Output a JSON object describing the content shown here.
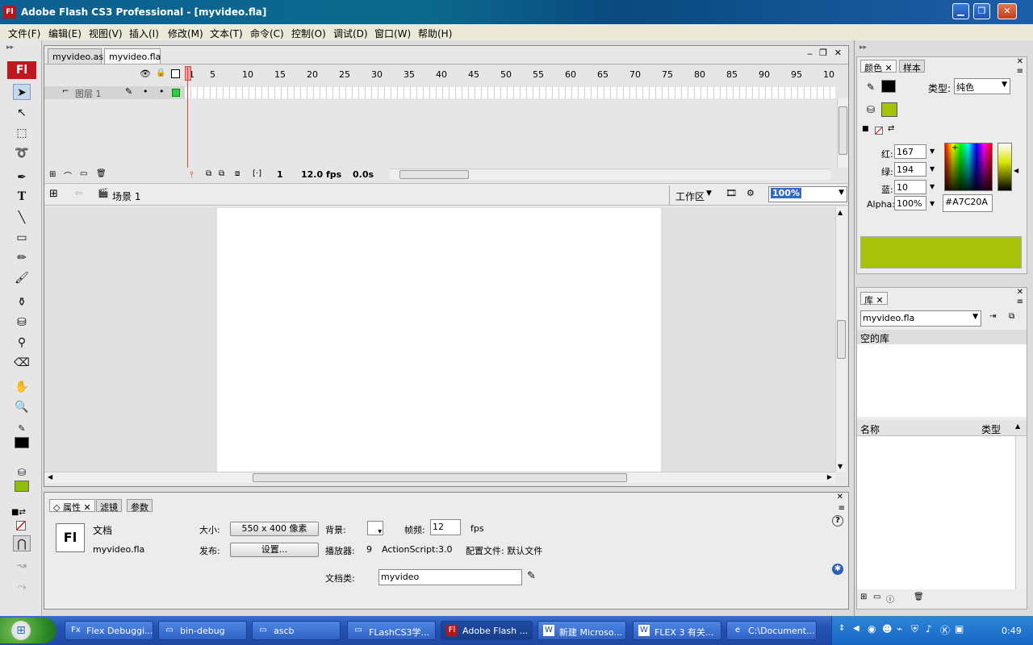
{
  "window": {
    "title": "Adobe Flash CS3 Professional - [myvideo.fla]",
    "app_icon": "Fl"
  },
  "menu": [
    "文件(F)",
    "编辑(E)",
    "视图(V)",
    "插入(I)",
    "修改(M)",
    "文本(T)",
    "命令(C)",
    "控制(O)",
    "调试(D)",
    "窗口(W)",
    "帮助(H)"
  ],
  "tools": {
    "logo": "Fl",
    "text_tool": "T"
  },
  "doc_tabs": [
    "myvideo.as",
    "myvideo.fla"
  ],
  "timeline": {
    "ruler": [
      "1",
      "5",
      "10",
      "15",
      "20",
      "25",
      "30",
      "35",
      "40",
      "45",
      "50",
      "55",
      "60",
      "65",
      "70",
      "75",
      "80",
      "85",
      "90",
      "95",
      "10"
    ],
    "layer_name": "图层 1",
    "current_frame": "1",
    "fps": "12.0 fps",
    "time": "0.0s"
  },
  "edit_bar": {
    "scene": "场景 1",
    "workspace": "工作区",
    "zoom": "100%"
  },
  "properties": {
    "tabs": [
      "属性",
      "滤镜",
      "参数"
    ],
    "icon_label": "Fl",
    "doc_type": "文档",
    "doc_name": "myvideo.fla",
    "size_label": "大小:",
    "size_button": "550 x 400 像素",
    "bg_label": "背景:",
    "framerate_label": "帧频:",
    "framerate_value": "12",
    "fps_unit": "fps",
    "publish_label": "发布:",
    "settings_button": "设置...",
    "player_label": "播放器:",
    "player_value": "9",
    "as_label": "ActionScript:",
    "as_value": "3.0",
    "profile": "配置文件: 默认文件",
    "docclass_label": "文档类:",
    "docclass_value": "myvideo"
  },
  "color_panel": {
    "tabs": [
      "颜色",
      "样本"
    ],
    "type_label": "类型:",
    "type_value": "纯色",
    "red_label": "红:",
    "red": "167",
    "green_label": "绿:",
    "green": "194",
    "blue_label": "蓝:",
    "blue": "10",
    "alpha_label": "Alpha:",
    "alpha": "100%",
    "hex": "#A7C20A",
    "fill_color": "#A7C20A"
  },
  "library_panel": {
    "tab": "库",
    "doc": "myvideo.fla",
    "empty": "空的库",
    "col_name": "名称",
    "col_type": "类型"
  },
  "taskbar": {
    "items": [
      "Flex Debuggi...",
      "bin-debug",
      "ascb",
      "FLashCS3学...",
      "Adobe Flash ...",
      "新建 Microso...",
      "FLEX 3 有关...",
      "C:\\Document..."
    ],
    "clock": "0:49"
  }
}
